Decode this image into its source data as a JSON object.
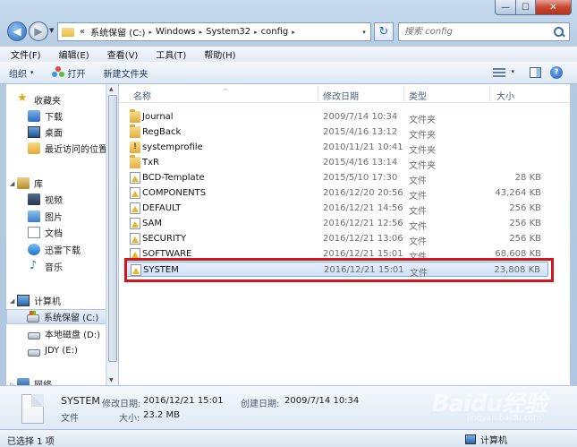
{
  "window": {
    "caption_min": "—",
    "caption_max": "☐",
    "caption_close": "✕"
  },
  "address_bar": {
    "history_chevron": "«",
    "segments": [
      "系统保留 (C:)",
      "Windows",
      "System32",
      "config"
    ],
    "separator": "▸",
    "dropdown": "▾"
  },
  "search": {
    "placeholder": "搜索 config"
  },
  "menu": [
    "文件(F)",
    "编辑(E)",
    "查看(V)",
    "工具(T)",
    "帮助(H)"
  ],
  "commands": {
    "organize": "组织",
    "open": "打开",
    "new_folder": "新建文件夹",
    "dropdown": "▾"
  },
  "nav": {
    "favorites": {
      "label": "收藏夹",
      "items": [
        "下载",
        "桌面",
        "最近访问的位置"
      ]
    },
    "libraries": {
      "label": "库",
      "items": [
        "视频",
        "图片",
        "文档",
        "迅雷下载",
        "音乐"
      ]
    },
    "computer": {
      "label": "计算机",
      "items": [
        "系统保留 (C:)",
        "本地磁盘 (D:)",
        "JDY (E:)"
      ]
    },
    "network": {
      "label": "网络"
    }
  },
  "columns": {
    "name": "名称",
    "date": "修改日期",
    "type": "类型",
    "size": "大小"
  },
  "files": [
    {
      "name": "Journal",
      "date": "2009/7/14 10:34",
      "type": "文件夹",
      "size": "",
      "icon": "folder-icon"
    },
    {
      "name": "RegBack",
      "date": "2015/4/16 13:12",
      "type": "文件夹",
      "size": "",
      "icon": "folder-icon"
    },
    {
      "name": "systemprofile",
      "date": "2010/11/21 10:41",
      "type": "文件夹",
      "size": "",
      "icon": "system-folder-icon"
    },
    {
      "name": "TxR",
      "date": "2015/4/16 13:14",
      "type": "文件夹",
      "size": "",
      "icon": "folder-icon"
    },
    {
      "name": "BCD-Template",
      "date": "2015/5/10 17:30",
      "type": "文件",
      "size": "28 KB",
      "icon": "file-icon"
    },
    {
      "name": "COMPONENTS",
      "date": "2016/12/20 20:56",
      "type": "文件",
      "size": "43,264 KB",
      "icon": "file-icon"
    },
    {
      "name": "DEFAULT",
      "date": "2016/12/21 14:56",
      "type": "文件",
      "size": "256 KB",
      "icon": "file-icon"
    },
    {
      "name": "SAM",
      "date": "2016/12/21 12:56",
      "type": "文件",
      "size": "256 KB",
      "icon": "file-icon"
    },
    {
      "name": "SECURITY",
      "date": "2016/12/21 13:06",
      "type": "文件",
      "size": "256 KB",
      "icon": "file-icon"
    },
    {
      "name": "SOFTWARE",
      "date": "2016/12/21 15:01",
      "type": "文件",
      "size": "68,608 KB",
      "icon": "file-icon"
    },
    {
      "name": "SYSTEM",
      "date": "2016/12/21 15:01",
      "type": "文件",
      "size": "23,808 KB",
      "icon": "file-icon",
      "selected": true
    }
  ],
  "details": {
    "name": "SYSTEM",
    "modified_label": "修改日期:",
    "modified_value": "2016/12/21 15:01",
    "created_label": "创建日期:",
    "created_value": "2009/7/14 10:34",
    "type": "文件",
    "size_label": "大小:",
    "size_value": "23.2 MB"
  },
  "status": {
    "selected": "已选择 1 项",
    "location": "计算机"
  },
  "watermark": {
    "main": "Baidu经验",
    "sub": "jingyan.baidu.com"
  },
  "colors": {
    "highlight_border": "#d4141b",
    "selection": "#cde0f6"
  }
}
